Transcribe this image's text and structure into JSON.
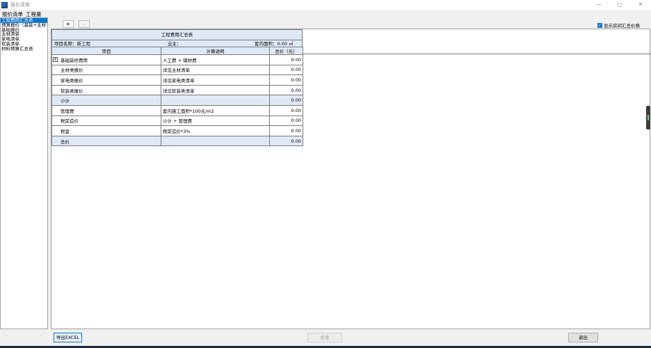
{
  "window": {
    "title": "报价清单",
    "min_label": "—",
    "restore_label": "▢",
    "close_label": "✕"
  },
  "menu": {
    "tabs": [
      "报价清单",
      "工程量"
    ]
  },
  "nav": {
    "items": [
      "工程费用汇总表",
      "预算报价（基装+主材",
      "基础报价",
      "主材清单",
      "家电清单",
      "软装清单",
      "材料预算汇总表"
    ],
    "active_index": 0
  },
  "toolbar": {
    "add_label": "+",
    "remove_label": "-"
  },
  "options": {
    "show_room_total_label": "显示房间汇总价格",
    "show_room_total_checked": true
  },
  "sheet": {
    "title": "工程费用汇总表",
    "project_label": "项目名称：新工程",
    "owner_label": "业主：",
    "area_label": "套内面积：0.00 ㎡",
    "columns": [
      "项目",
      "计算说明",
      "总价（元）"
    ],
    "rows": [
      {
        "item": "基础装修费用",
        "desc": "人工费 + 辅材费",
        "total": "0.00",
        "expand": true,
        "subtotal": false
      },
      {
        "item": "主材类报价",
        "desc": "详见主材清单",
        "total": "0.00",
        "expand": false,
        "subtotal": false
      },
      {
        "item": "家电类报价",
        "desc": "详见家电类清单",
        "total": "0.00",
        "expand": false,
        "subtotal": false
      },
      {
        "item": "软装类报价",
        "desc": "详见软装类清单",
        "total": "0.00",
        "expand": false,
        "subtotal": false
      },
      {
        "item": "小计",
        "desc": "",
        "total": "0.00",
        "expand": false,
        "subtotal": true
      },
      {
        "item": "管理费",
        "desc": "套内施工面积*100元/m2",
        "total": "0.00",
        "expand": false,
        "subtotal": false
      },
      {
        "item": "税前造价",
        "desc": "小计 + 管理费",
        "total": "0.00",
        "expand": false,
        "subtotal": false
      },
      {
        "item": "税金",
        "desc": "税前造价*3%",
        "total": "0.00",
        "expand": false,
        "subtotal": false
      },
      {
        "item": "总价",
        "desc": "",
        "total": "0.00",
        "expand": false,
        "subtotal": true
      }
    ]
  },
  "footer": {
    "export_label": "导出EXCEL",
    "review_label": "反查",
    "quit_label": "退出"
  }
}
